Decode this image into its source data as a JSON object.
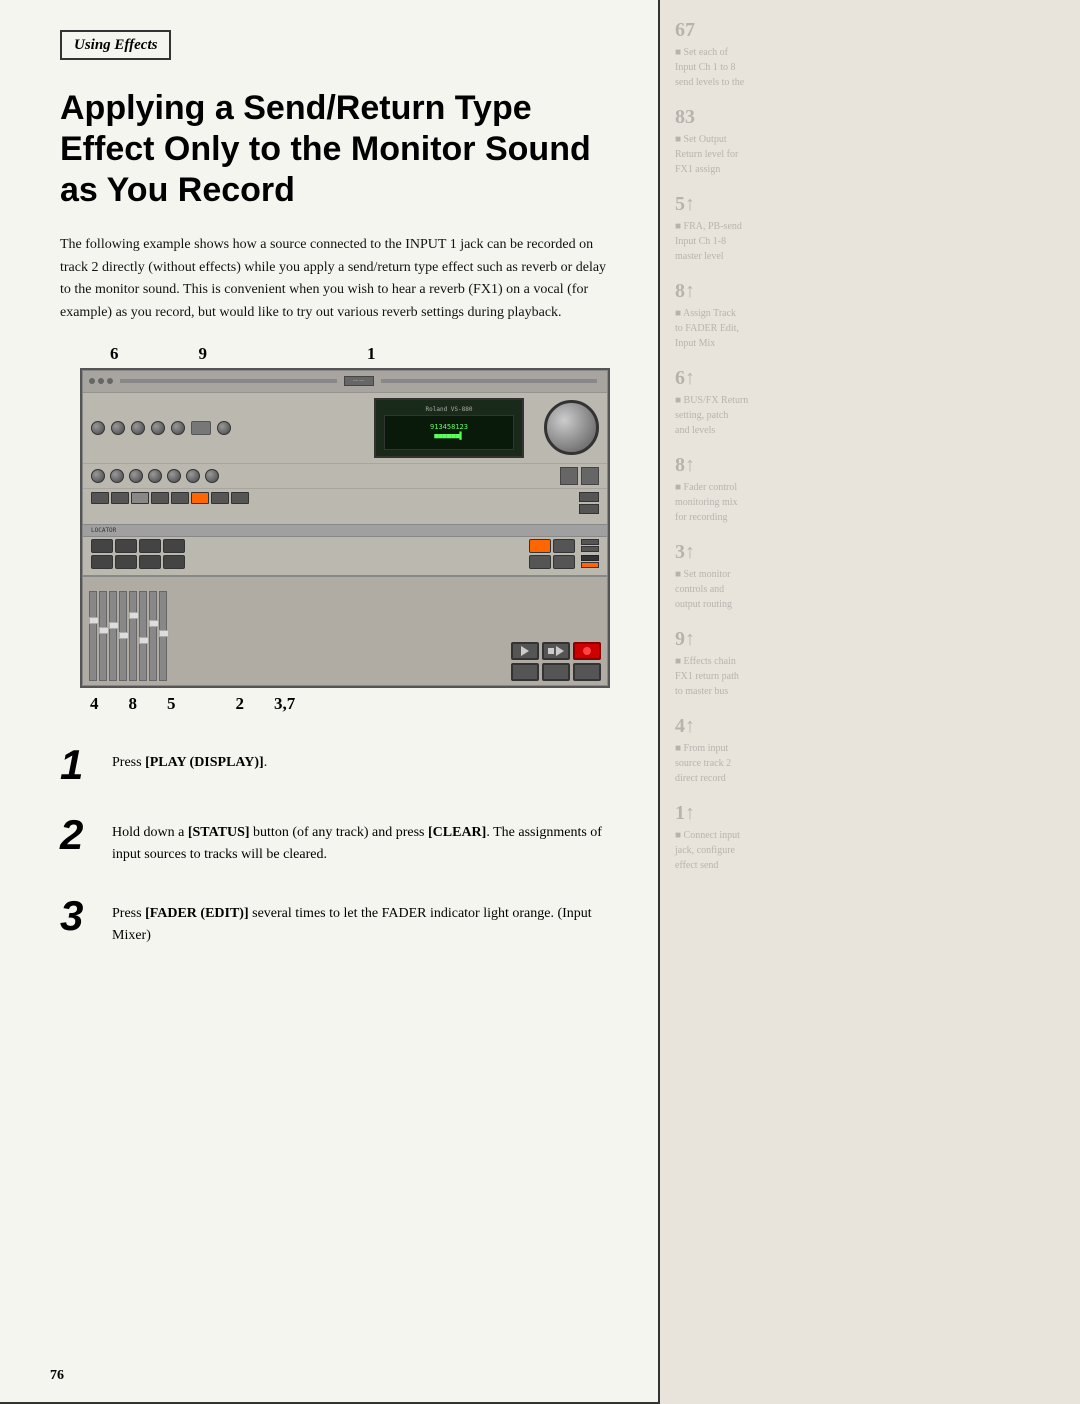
{
  "header": {
    "section_label": "Using Effects"
  },
  "title": {
    "main": "Applying a Send/Return Type Effect Only to the Monitor Sound as You Record"
  },
  "intro": {
    "paragraph": "The following example shows how a source connected to the INPUT 1 jack can be recorded on track 2 directly (without effects) while you apply a send/return type effect such as reverb or delay to the monitor sound. This is convenient when you wish to hear a reverb (FX1) on a vocal (for example) as you record, but would like to try out various reverb settings during playback."
  },
  "diagram": {
    "labels_top": [
      "6",
      "9",
      "1"
    ],
    "labels_bottom": [
      "4",
      "8",
      "5",
      "2",
      "3,7"
    ]
  },
  "steps": [
    {
      "number": "1",
      "text_before": "Press ",
      "bold": "[PLAY (DISPLAY)]",
      "text_after": ".",
      "extra": ""
    },
    {
      "number": "2",
      "text_before": "Hold down a ",
      "bold": "[STATUS]",
      "text_mid": " button (of any track) and press ",
      "bold2": "[CLEAR]",
      "text_after": ". The assignments of input sources to tracks will be cleared.",
      "extra": ""
    },
    {
      "number": "3",
      "text_before": "Press ",
      "bold": "[FADER (EDIT)]",
      "text_after": " several times to let the FADER indicator light orange. (Input Mixer)"
    }
  ],
  "page_number": "76",
  "sidebar": {
    "blocks": [
      {
        "numbers": "67",
        "lines": [
          "■ Set each of",
          "Input Ch 1 to 8",
          "send levels to the"
        ]
      },
      {
        "numbers": "83",
        "lines": [
          "■ Set Output",
          "Return level for",
          "FX1 assign"
        ]
      },
      {
        "numbers": "5↑",
        "lines": [
          "■ FRA, PB-send",
          "Input Ch 1-8",
          "master level"
        ]
      },
      {
        "numbers": "8↑",
        "lines": [
          "■ Assign Track",
          "to FADER Edit,",
          "Input Mix"
        ]
      },
      {
        "numbers": "6↑",
        "lines": [
          "■ BUS/FX Return",
          "setting, patch",
          "and levels"
        ]
      },
      {
        "numbers": "8↑",
        "lines": [
          "■ Fader control",
          "monitoring mix",
          "for recording"
        ]
      },
      {
        "numbers": "3↑",
        "lines": [
          "■ Set monitor",
          "controls and",
          "output routing"
        ]
      },
      {
        "numbers": "9↑",
        "lines": [
          "■ Effects chain",
          "FX1 return path",
          "to master bus"
        ]
      },
      {
        "numbers": "4↑",
        "lines": [
          "■ From input",
          "source track 2",
          "direct record"
        ]
      },
      {
        "numbers": "1↑",
        "lines": [
          "■ Connect input",
          "jack, configure",
          "effect send"
        ]
      }
    ]
  }
}
